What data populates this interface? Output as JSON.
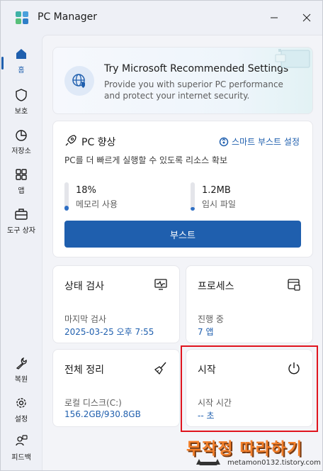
{
  "window": {
    "title": "PC Manager"
  },
  "sidebar": {
    "items": [
      {
        "label": "홈",
        "icon": "home-icon",
        "active": true
      },
      {
        "label": "보호",
        "icon": "shield-icon"
      },
      {
        "label": "저장소",
        "icon": "pie-chart-icon"
      },
      {
        "label": "앱",
        "icon": "apps-grid-icon"
      },
      {
        "label": "도구 상자",
        "icon": "toolbox-icon"
      },
      {
        "label": "복원",
        "icon": "wrench-icon"
      },
      {
        "label": "설정",
        "icon": "gear-icon"
      },
      {
        "label": "피드백",
        "icon": "feedback-icon"
      }
    ]
  },
  "banner": {
    "title": "Try Microsoft Recommended Settings",
    "description": "Provide you with superior PC performance and protect your internet security."
  },
  "boost": {
    "title": "PC 향상",
    "smart_boost_link": "스마트 부스트 설정",
    "subtitle": "PC를 더 빠르게 실행할 수 있도록 리소스 확보",
    "memory": {
      "value": "18%",
      "label": "메모리 사용",
      "level": 0.18
    },
    "temp": {
      "value": "1.2MB",
      "label": "임시 파일",
      "level": 0.12
    },
    "button_label": "부스트"
  },
  "tiles": {
    "health": {
      "title": "상태 검사",
      "label": "마지막 검사",
      "value": "2025-03-25 오후 7:55"
    },
    "process": {
      "title": "프로세스",
      "label": "진행 중",
      "value": "7 앱"
    },
    "cleanup": {
      "title": "전체 정리",
      "label": "로컬 디스크(C:)",
      "value": "156.2GB/930.8GB"
    },
    "startup": {
      "title": "시작",
      "label": "시작 시간",
      "value": "-- 초"
    }
  },
  "watermark": {
    "title": "무작정 따라하기",
    "url": "metamon0132.tistory.com"
  },
  "colors": {
    "accent": "#1f5fae",
    "highlight_box": "#e0141e",
    "watermark": "#f27f2a"
  }
}
